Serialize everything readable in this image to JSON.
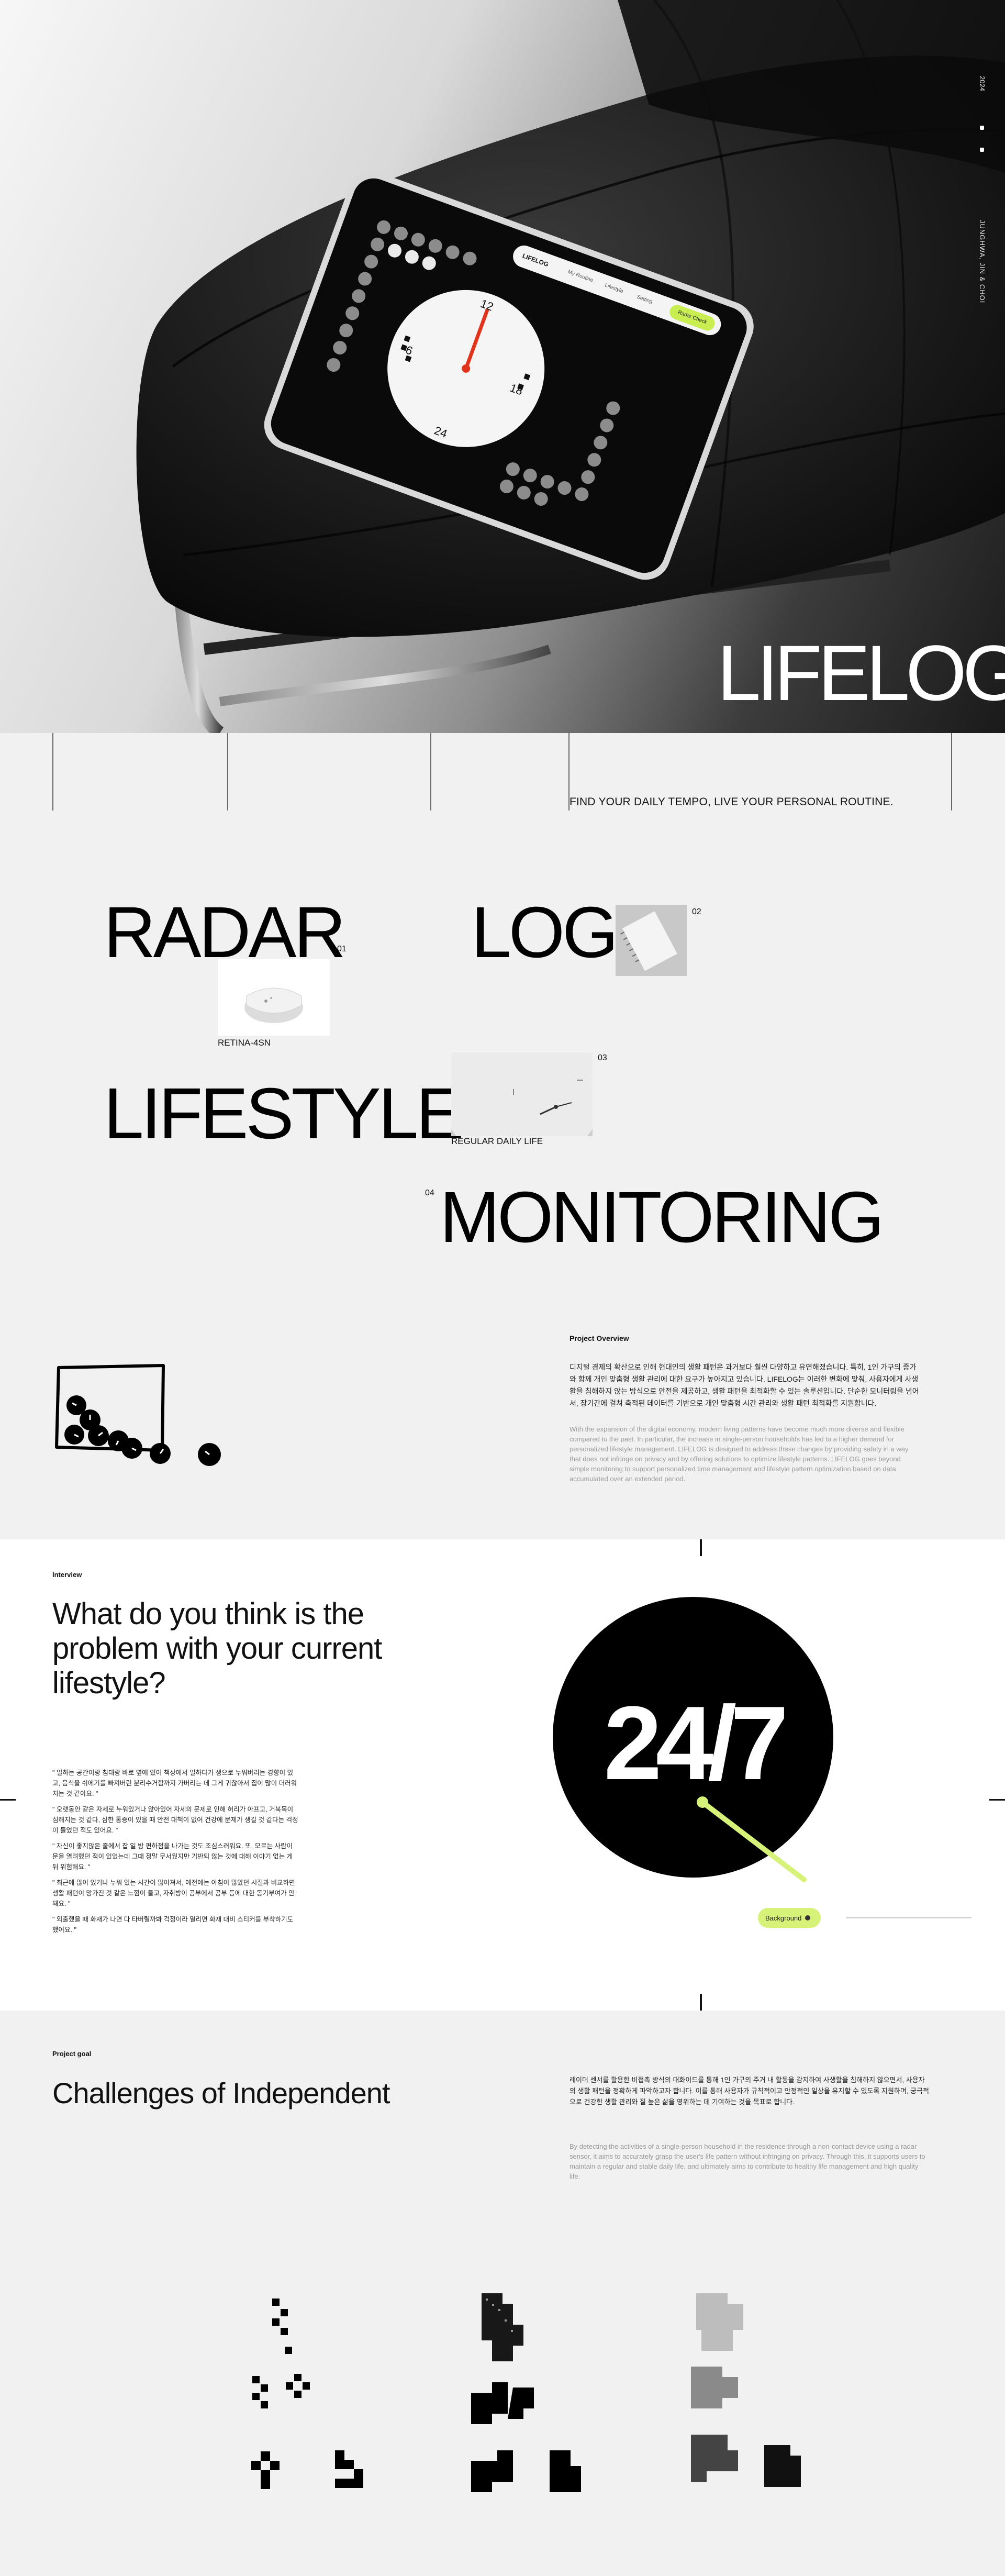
{
  "hero": {
    "year": "2024",
    "credit": "JUNGHWA, JIN & CHOI",
    "logo": "LIFELOG.",
    "tablet": {
      "brand": "LIFELOG",
      "tabs": [
        "My Routine",
        "Lifestyle",
        "Setting"
      ],
      "status": "Radar Check",
      "clock_numbers": [
        "12",
        "6",
        "18",
        "24"
      ]
    }
  },
  "tagline": "FIND YOUR DAILY TEMPO, LIVE YOUR PERSONAL ROUTINE.",
  "keywords": [
    {
      "word": "RADAR",
      "num": "01",
      "caption": "RETINA-4SN"
    },
    {
      "word": "LOG",
      "num": "02"
    },
    {
      "word": "LIFESTYLE",
      "num": "03",
      "caption": "REGULAR DAILY LIFE"
    },
    {
      "word": "MONITORING",
      "num": "04"
    }
  ],
  "overview": {
    "title": "Project Overview",
    "ko": "디지털 경제의 확산으로 인해 현대인의 생활 패턴은 과거보다 훨씬 다양하고 유연해졌습니다. 특히, 1인 가구의 증가와 함께 개인 맞춤형 생활 관리에 대한 요구가 높아지고 있습니다. LIFELOG는 이러한 변화에 맞춰, 사용자에게 사생활을 침해하지 않는 방식으로 안전을 제공하고, 생활 패턴을 최적화할 수 있는 솔루션입니다. 단순한 모니터링을 넘어서, 장기간에 걸쳐 축적된 데이터를 기반으로 개인 맞춤형 시간 관리와 생활 패턴 최적화를 지원합니다.",
    "en": "With the expansion of the digital economy, modern living patterns have become much more diverse and flexible compared to the past. In particular, the increase in single-person households has led to a higher demand for personalized lifestyle management. LIFELOG is designed to address these changes by providing safety in a way that does not infringe on privacy and by offering solutions to optimize lifestyle patterns. LIFELOG goes beyond simple monitoring to support personalized time management and lifestyle pattern optimization based on data accumulated over an extended period."
  },
  "interview": {
    "label": "Interview",
    "question": "What do you think is the problem with your current lifestyle?",
    "quotes": [
      "\" 일하는 공간이랑 침대랑 바로 옆에 있어 책상에서 일하다가 생으로 누워버리는 경향이 있고, 음식을 쉬에기를 빠져버린 분리수거함까지 가버리는 데 그게 귀찮아서 집이 많이 더러워지는 것 같아요. \"",
      "\" 오랫동안 같은 자세로 누워있거나 앉아있어 자세의 문제로 인해 허리가 아프고, 거북목이 심해지는 것 같다, 심한 통증이 있을 때 안전 대책이 없어 건강에 문제가 생길 것 같다는 걱정이 들었던 적도 있어요. \"",
      "\" 자신이 좋지않은 줄에서 잡 일 방 편하점을 나가는 것도 조심스러워요. 또, 모르는 사람이 문을 열려했던 적이 있었는데 그때 정말 무서웠지만 기반되 않는 것에 대해 이야기 없는 게 뒤 위험해요. \"",
      "\" 최근에 많이 있거나 누워 있는 시간이 많아져서, 예전에는 아침이 많았던 시절과 비교하면 생활 패턴이 망가진 것 같은 느낌이 들고, 자취방이 공부에서 공부 등에 대한 동기부여가 안 돼요. \"",
      "\" 외출했을 때 화재가 나면 다 타버릴까봐 걱정이라 열리면 화재 대비 스티커를 부착하기도 했어요. \""
    ],
    "clock_text": "24/7",
    "pill_label": "Background"
  },
  "goal": {
    "label": "Project goal",
    "title": "Challenges of Independent",
    "ko": "레이더 센서를 활용한 비접촉 방식의 대화이드를 통해 1인 가구의 주거 내 활동을 감지하여 사생활을 침해하지 않으면서, 사용자의 생활 패턴을 정확하게 파악하고자 합니다. 이를 통해 사용자가 규칙적이고 안정적인 일상을 유지할 수 있도록 지원하며, 궁극적으로 건강한 생활 관리와 질 높은 삶을 영위하는 데 기여하는 것을 목표로 합니다.",
    "en": "By detecting the activities of a single-person household in the residence through a non-contact device using a radar sensor, it aims to accurately grasp the user's life pattern without infringing on privacy. Through this, it supports users to maintain a regular and stable daily life, and ultimately aims to contribute to healthy life management and high quality life."
  },
  "colors": {
    "accent": "#d7f279",
    "accent_strong": "#c9ee52",
    "hand": "#e2341d",
    "ink": "#000000"
  }
}
